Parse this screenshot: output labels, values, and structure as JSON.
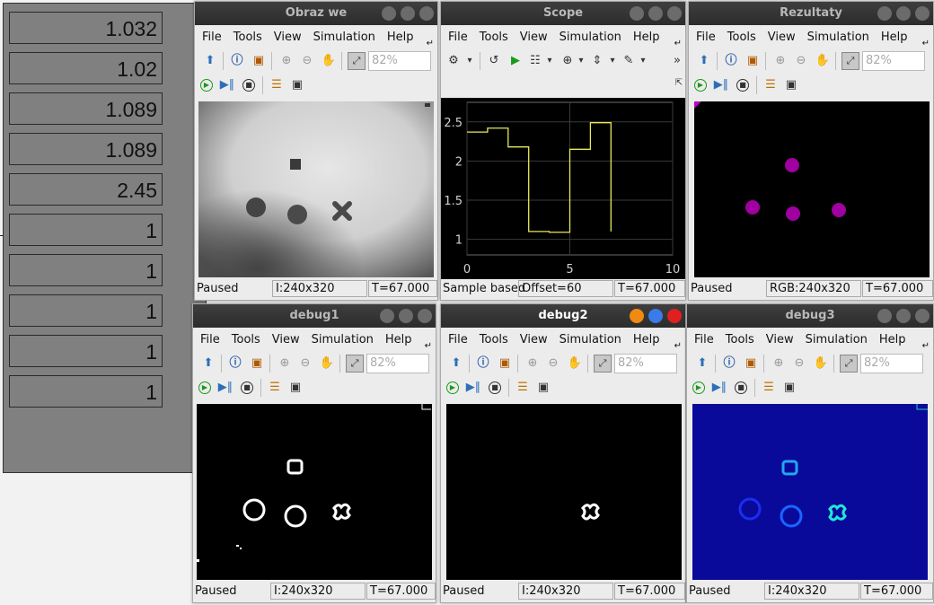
{
  "display_values": [
    "1.032",
    "1.02",
    "1.089",
    "1.089",
    "2.45",
    "1",
    "1",
    "1",
    "1",
    "1"
  ],
  "menu": [
    "File",
    "Tools",
    "View",
    "Simulation",
    "Help"
  ],
  "zoom_placeholder": "82%",
  "windows": {
    "obraz": {
      "title": "Obraz we",
      "status": "Paused",
      "info": "I:240x320",
      "time": "T=67.000"
    },
    "scope": {
      "title": "Scope",
      "status": "Sample based",
      "info": "Offset=60",
      "time": "T=67.000"
    },
    "rezultaty": {
      "title": "Rezultaty",
      "status": "Paused",
      "info": "RGB:240x320",
      "time": "T=67.000"
    },
    "debug1": {
      "title": "debug1",
      "status": "Paused",
      "info": "I:240x320",
      "time": "T=67.000"
    },
    "debug2": {
      "title": "debug2",
      "status": "Paused",
      "info": "I:240x320",
      "time": "T=67.000"
    },
    "debug3": {
      "title": "debug3",
      "status": "Paused",
      "info": "I:240x320",
      "time": "T=67.000"
    }
  },
  "colors": {
    "accent_close": "#e02020",
    "accent_orange": "#f08a10",
    "accent_blue": "#3a7be8",
    "scope_line": "#e8e85a",
    "blob_magenta": "#a000a0",
    "debug3_bg": "#0a0a9a"
  },
  "chart_data": {
    "type": "line",
    "xlim": [
      0,
      10
    ],
    "ylim": [
      0.8,
      2.75
    ],
    "xticks": [
      "0",
      "5",
      "10"
    ],
    "yticks": [
      "1",
      "1.5",
      "2",
      "2.5"
    ],
    "grid": true,
    "series": [
      {
        "color": "#e8e85a",
        "step": true,
        "x": [
          0,
          1,
          2,
          3,
          4,
          5,
          6,
          7
        ],
        "y": [
          2.37,
          2.42,
          2.18,
          1.1,
          1.09,
          2.15,
          2.49,
          1.1
        ]
      }
    ]
  }
}
